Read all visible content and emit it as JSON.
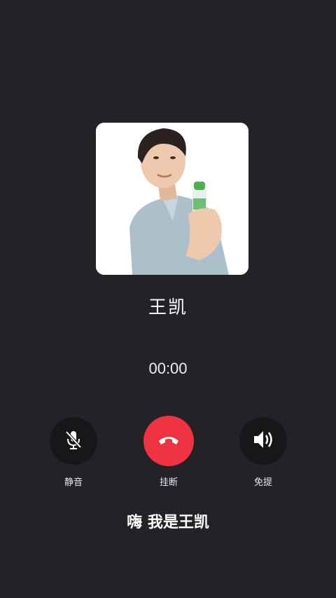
{
  "caller": {
    "name": "王凯",
    "avatar_label": "caller-portrait"
  },
  "call": {
    "timer": "00:00"
  },
  "controls": {
    "mute_label": "静音",
    "hangup_label": "挂断",
    "speaker_label": "免提"
  },
  "subtitle": "嗨 我是王凯",
  "colors": {
    "background": "#222227",
    "hangup": "#ef3343",
    "control_bg": "#17171a"
  }
}
